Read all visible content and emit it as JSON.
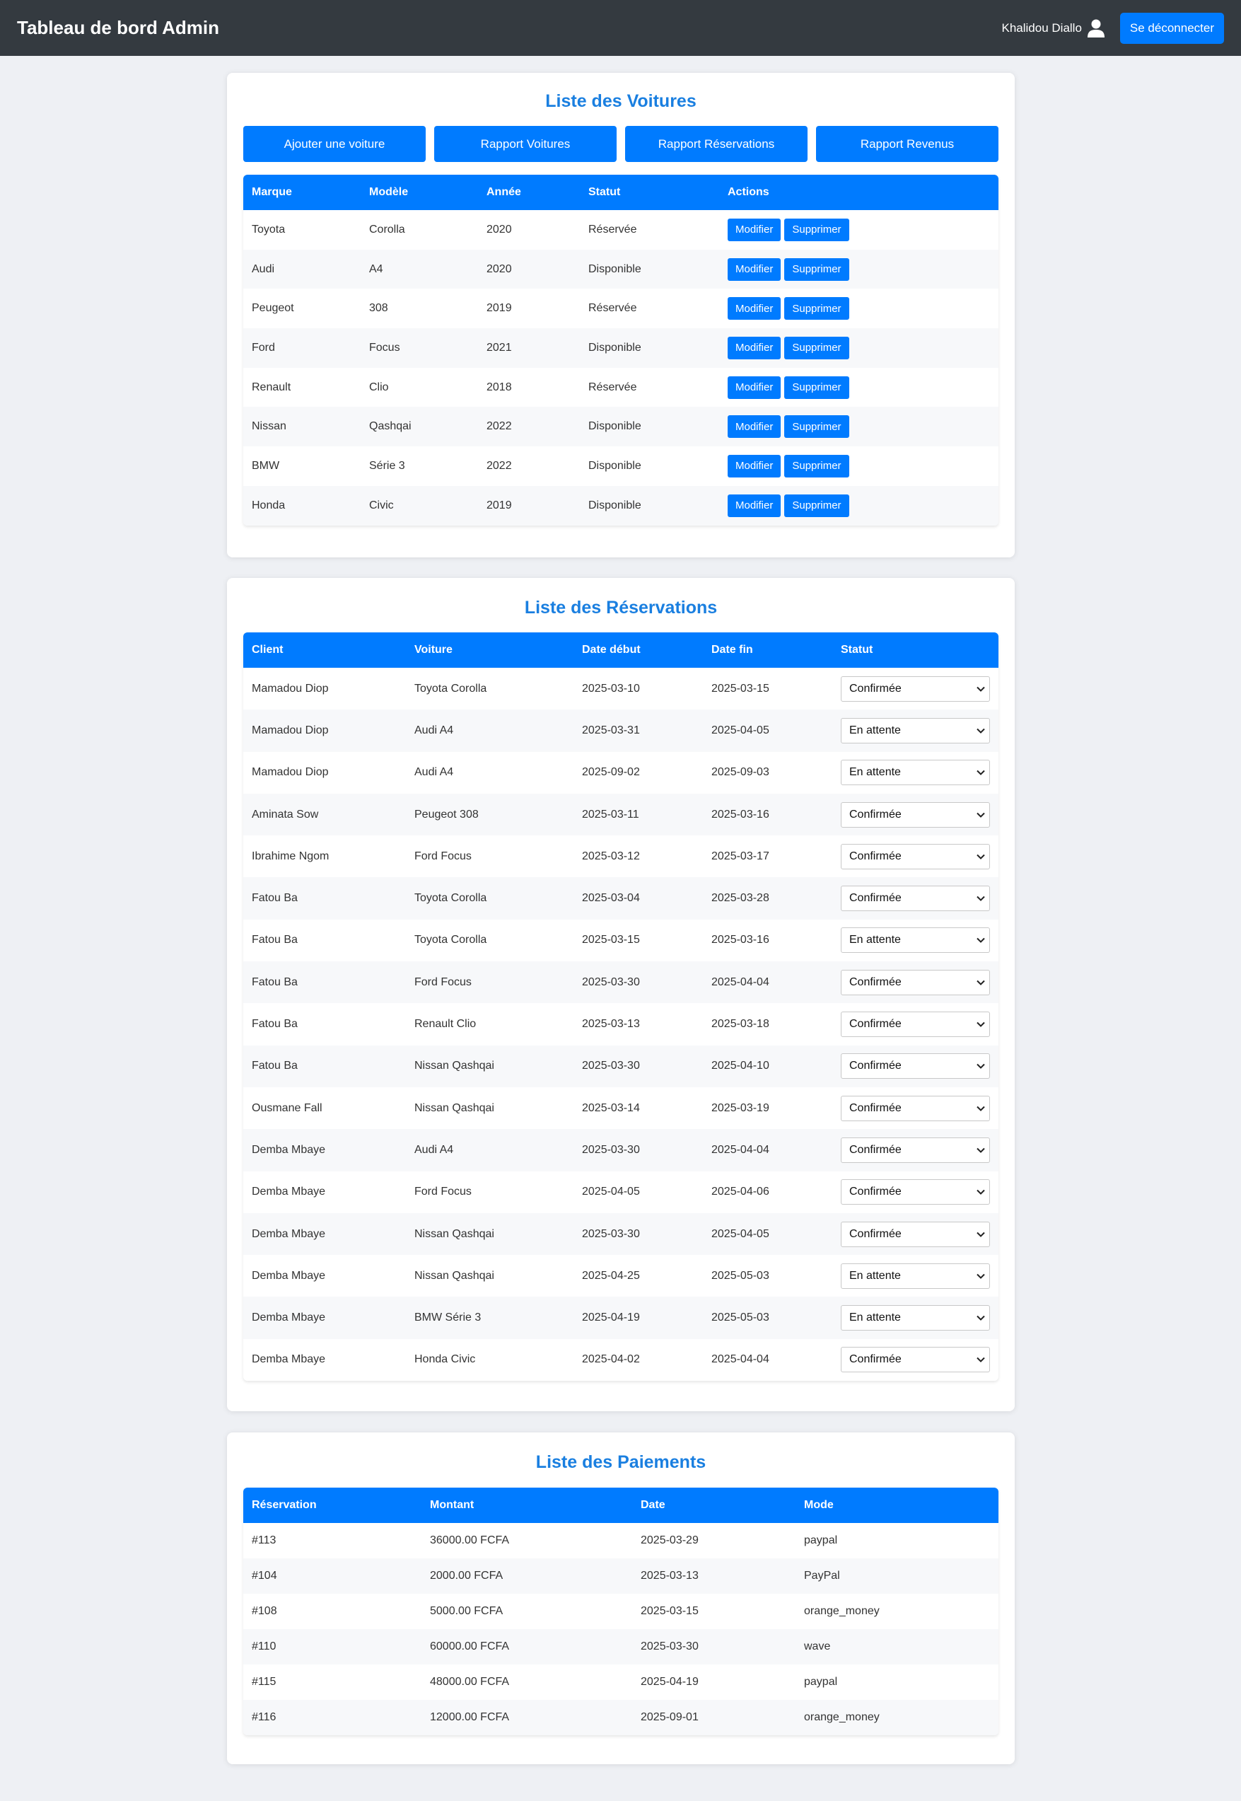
{
  "header": {
    "title": "Tableau de bord Admin",
    "user_name": "Khalidou Diallo",
    "logout_label": "Se déconnecter"
  },
  "cars": {
    "title": "Liste des Voitures",
    "buttons": [
      "Ajouter une voiture",
      "Rapport Voitures",
      "Rapport Réservations",
      "Rapport Revenus"
    ],
    "columns": [
      "Marque",
      "Modèle",
      "Année",
      "Statut",
      "Actions"
    ],
    "edit_label": "Modifier",
    "delete_label": "Supprimer",
    "rows": [
      [
        "Toyota",
        "Corolla",
        "2020",
        "Réservée"
      ],
      [
        "Audi",
        "A4",
        "2020",
        "Disponible"
      ],
      [
        "Peugeot",
        "308",
        "2019",
        "Réservée"
      ],
      [
        "Ford",
        "Focus",
        "2021",
        "Disponible"
      ],
      [
        "Renault",
        "Clio",
        "2018",
        "Réservée"
      ],
      [
        "Nissan",
        "Qashqai",
        "2022",
        "Disponible"
      ],
      [
        "BMW",
        "Série 3",
        "2022",
        "Disponible"
      ],
      [
        "Honda",
        "Civic",
        "2019",
        "Disponible"
      ]
    ]
  },
  "reservations": {
    "title": "Liste des Réservations",
    "columns": [
      "Client",
      "Voiture",
      "Date début",
      "Date fin",
      "Statut"
    ],
    "rows": [
      [
        "Mamadou Diop",
        "Toyota Corolla",
        "2025-03-10",
        "2025-03-15",
        "Confirmée"
      ],
      [
        "Mamadou Diop",
        "Audi A4",
        "2025-03-31",
        "2025-04-05",
        "En attente"
      ],
      [
        "Mamadou Diop",
        "Audi A4",
        "2025-09-02",
        "2025-09-03",
        "En attente"
      ],
      [
        "Aminata Sow",
        "Peugeot 308",
        "2025-03-11",
        "2025-03-16",
        "Confirmée"
      ],
      [
        "Ibrahime Ngom",
        "Ford Focus",
        "2025-03-12",
        "2025-03-17",
        "Confirmée"
      ],
      [
        "Fatou Ba",
        "Toyota Corolla",
        "2025-03-04",
        "2025-03-28",
        "Confirmée"
      ],
      [
        "Fatou Ba",
        "Toyota Corolla",
        "2025-03-15",
        "2025-03-16",
        "En attente"
      ],
      [
        "Fatou Ba",
        "Ford Focus",
        "2025-03-30",
        "2025-04-04",
        "Confirmée"
      ],
      [
        "Fatou Ba",
        "Renault Clio",
        "2025-03-13",
        "2025-03-18",
        "Confirmée"
      ],
      [
        "Fatou Ba",
        "Nissan Qashqai",
        "2025-03-30",
        "2025-04-10",
        "Confirmée"
      ],
      [
        "Ousmane Fall",
        "Nissan Qashqai",
        "2025-03-14",
        "2025-03-19",
        "Confirmée"
      ],
      [
        "Demba Mbaye",
        "Audi A4",
        "2025-03-30",
        "2025-04-04",
        "Confirmée"
      ],
      [
        "Demba Mbaye",
        "Ford Focus",
        "2025-04-05",
        "2025-04-06",
        "Confirmée"
      ],
      [
        "Demba Mbaye",
        "Nissan Qashqai",
        "2025-03-30",
        "2025-04-05",
        "Confirmée"
      ],
      [
        "Demba Mbaye",
        "Nissan Qashqai",
        "2025-04-25",
        "2025-05-03",
        "En attente"
      ],
      [
        "Demba Mbaye",
        "BMW Série 3",
        "2025-04-19",
        "2025-05-03",
        "En attente"
      ],
      [
        "Demba Mbaye",
        "Honda Civic",
        "2025-04-02",
        "2025-04-04",
        "Confirmée"
      ]
    ]
  },
  "payments": {
    "title": "Liste des Paiements",
    "columns": [
      "Réservation",
      "Montant",
      "Date",
      "Mode"
    ],
    "rows": [
      [
        "#113",
        "36000.00 FCFA",
        "2025-03-29",
        "paypal"
      ],
      [
        "#104",
        "2000.00 FCFA",
        "2025-03-13",
        "PayPal"
      ],
      [
        "#108",
        "5000.00 FCFA",
        "2025-03-15",
        "orange_money"
      ],
      [
        "#110",
        "60000.00 FCFA",
        "2025-03-30",
        "wave"
      ],
      [
        "#115",
        "48000.00 FCFA",
        "2025-04-19",
        "paypal"
      ],
      [
        "#116",
        "12000.00 FCFA",
        "2025-09-01",
        "orange_money"
      ]
    ]
  },
  "colors": {
    "accent": "#007bff",
    "title": "#1a7fe0",
    "navbar": "#343a40"
  }
}
